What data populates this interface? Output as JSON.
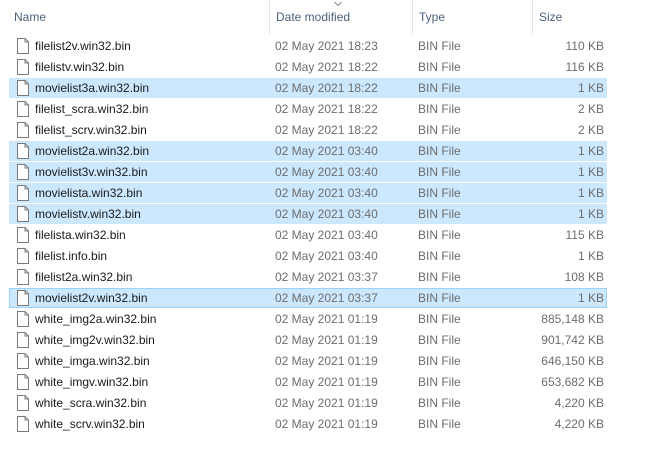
{
  "columns": {
    "name": "Name",
    "date": "Date modified",
    "type": "Type",
    "size": "Size",
    "sort_icon": "chevron-down-icon"
  },
  "files": [
    {
      "name": "filelist2v.win32.bin",
      "date": "02 May 2021 18:23",
      "type": "BIN File",
      "size": "110 KB",
      "state": "normal"
    },
    {
      "name": "filelistv.win32.bin",
      "date": "02 May 2021 18:22",
      "type": "BIN File",
      "size": "116 KB",
      "state": "normal"
    },
    {
      "name": "movielist3a.win32.bin",
      "date": "02 May 2021 18:22",
      "type": "BIN File",
      "size": "1 KB",
      "state": "selected"
    },
    {
      "name": "filelist_scra.win32.bin",
      "date": "02 May 2021 18:22",
      "type": "BIN File",
      "size": "2 KB",
      "state": "normal"
    },
    {
      "name": "filelist_scrv.win32.bin",
      "date": "02 May 2021 18:22",
      "type": "BIN File",
      "size": "2 KB",
      "state": "normal"
    },
    {
      "name": "movielist2a.win32.bin",
      "date": "02 May 2021 03:40",
      "type": "BIN File",
      "size": "1 KB",
      "state": "selected"
    },
    {
      "name": "movielist3v.win32.bin",
      "date": "02 May 2021 03:40",
      "type": "BIN File",
      "size": "1 KB",
      "state": "selected"
    },
    {
      "name": "movielista.win32.bin",
      "date": "02 May 2021 03:40",
      "type": "BIN File",
      "size": "1 KB",
      "state": "selected"
    },
    {
      "name": "movielistv.win32.bin",
      "date": "02 May 2021 03:40",
      "type": "BIN File",
      "size": "1 KB",
      "state": "selected"
    },
    {
      "name": "filelista.win32.bin",
      "date": "02 May 2021 03:40",
      "type": "BIN File",
      "size": "115 KB",
      "state": "normal"
    },
    {
      "name": "filelist.info.bin",
      "date": "02 May 2021 03:40",
      "type": "BIN File",
      "size": "1 KB",
      "state": "normal"
    },
    {
      "name": "filelist2a.win32.bin",
      "date": "02 May 2021 03:37",
      "type": "BIN File",
      "size": "108 KB",
      "state": "normal"
    },
    {
      "name": "movielist2v.win32.bin",
      "date": "02 May 2021 03:37",
      "type": "BIN File",
      "size": "1 KB",
      "state": "focused"
    },
    {
      "name": "white_img2a.win32.bin",
      "date": "02 May 2021 01:19",
      "type": "BIN File",
      "size": "885,148 KB",
      "state": "normal"
    },
    {
      "name": "white_img2v.win32.bin",
      "date": "02 May 2021 01:19",
      "type": "BIN File",
      "size": "901,742 KB",
      "state": "normal"
    },
    {
      "name": "white_imga.win32.bin",
      "date": "02 May 2021 01:19",
      "type": "BIN File",
      "size": "646,150 KB",
      "state": "normal"
    },
    {
      "name": "white_imgv.win32.bin",
      "date": "02 May 2021 01:19",
      "type": "BIN File",
      "size": "653,682 KB",
      "state": "normal"
    },
    {
      "name": "white_scra.win32.bin",
      "date": "02 May 2021 01:19",
      "type": "BIN File",
      "size": "4,220 KB",
      "state": "normal"
    },
    {
      "name": "white_scrv.win32.bin",
      "date": "02 May 2021 01:19",
      "type": "BIN File",
      "size": "4,220 KB",
      "state": "normal"
    }
  ],
  "colors": {
    "selection_fill": "#cce8ff",
    "focus_border": "#99d1ff",
    "header_text": "#4c607a",
    "secondary_text": "#6d6d6d"
  },
  "file_icon": "file-icon"
}
